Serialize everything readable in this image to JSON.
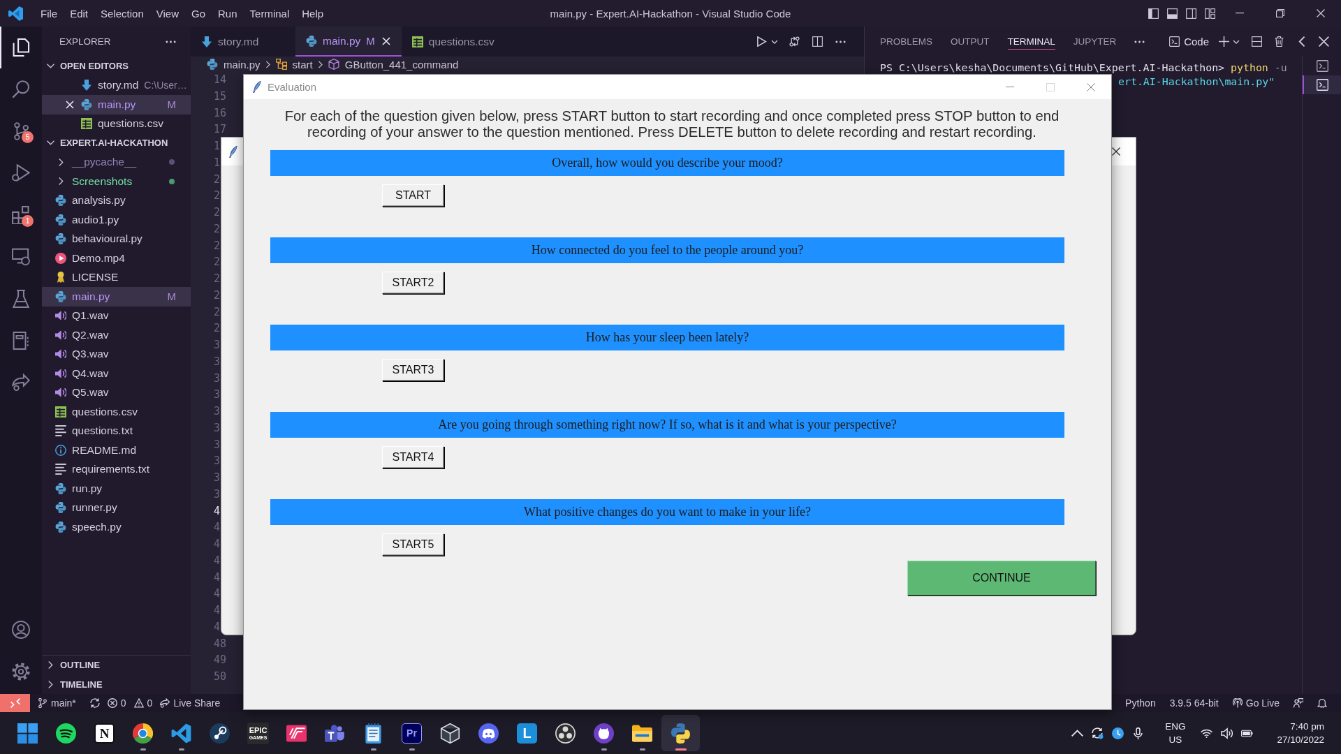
{
  "title_bar": {
    "menu": [
      "File",
      "Edit",
      "Selection",
      "View",
      "Go",
      "Run",
      "Terminal",
      "Help"
    ],
    "title": "main.py - Expert.AI-Hackathon - Visual Studio Code"
  },
  "activity_bar": {
    "items": [
      {
        "kind": "explorer",
        "selected": true
      },
      {
        "kind": "search",
        "selected": false
      },
      {
        "kind": "source-control",
        "selected": false,
        "badge": "5"
      },
      {
        "kind": "run-debug",
        "selected": false
      },
      {
        "kind": "extensions",
        "selected": false,
        "badge": "1"
      },
      {
        "kind": "remote",
        "selected": false
      },
      {
        "kind": "testing",
        "selected": false
      },
      {
        "kind": "notebook",
        "selected": false
      },
      {
        "kind": "live-share",
        "selected": false
      }
    ],
    "bottom": [
      {
        "kind": "account"
      },
      {
        "kind": "settings"
      }
    ]
  },
  "sidebar": {
    "title": "EXPLORER",
    "open_editors": {
      "label": "OPEN EDITORS",
      "expanded": true,
      "items": [
        {
          "name": "story.md",
          "kind": "markdown",
          "path": "C:\\User…",
          "selected": false,
          "close": false,
          "modified": false
        },
        {
          "name": "main.py",
          "kind": "python",
          "selected": true,
          "close": true,
          "modified": true,
          "badge": "M"
        },
        {
          "name": "questions.csv",
          "kind": "csv",
          "selected": false,
          "close": false,
          "modified": false
        }
      ]
    },
    "folder": {
      "label": "EXPERT.AI-HACKATHON",
      "expanded": true,
      "items": [
        {
          "name": "__pycache__",
          "kind": "folder",
          "expanded": false,
          "selected": false,
          "modified": false,
          "ignored": true,
          "untracked": false
        },
        {
          "name": "Screenshots",
          "kind": "folder",
          "expanded": false,
          "selected": false,
          "modified": false,
          "ignored": false,
          "untracked": true
        },
        {
          "name": "analysis.py",
          "kind": "python",
          "selected": false,
          "modified": false,
          "ignored": false,
          "untracked": false
        },
        {
          "name": "audio1.py",
          "kind": "python",
          "selected": false,
          "modified": false,
          "ignored": false,
          "untracked": false
        },
        {
          "name": "behavioural.py",
          "kind": "python",
          "selected": false,
          "modified": false,
          "ignored": false,
          "untracked": false
        },
        {
          "name": "Demo.mp4",
          "kind": "video",
          "selected": false,
          "modified": false,
          "ignored": false,
          "untracked": false
        },
        {
          "name": "LICENSE",
          "kind": "license",
          "selected": false,
          "modified": false,
          "ignored": false,
          "untracked": false
        },
        {
          "name": "main.py",
          "kind": "python",
          "selected": true,
          "modified": true,
          "ignored": false,
          "untracked": false,
          "badge": "M"
        },
        {
          "name": "Q1.wav",
          "kind": "audio",
          "selected": false,
          "modified": false,
          "ignored": false,
          "untracked": false
        },
        {
          "name": "Q2.wav",
          "kind": "audio",
          "selected": false,
          "modified": false,
          "ignored": false,
          "untracked": false
        },
        {
          "name": "Q3.wav",
          "kind": "audio",
          "selected": false,
          "modified": false,
          "ignored": false,
          "untracked": false
        },
        {
          "name": "Q4.wav",
          "kind": "audio",
          "selected": false,
          "modified": false,
          "ignored": false,
          "untracked": false
        },
        {
          "name": "Q5.wav",
          "kind": "audio",
          "selected": false,
          "modified": false,
          "ignored": false,
          "untracked": false
        },
        {
          "name": "questions.csv",
          "kind": "csv",
          "selected": false,
          "modified": false,
          "ignored": false,
          "untracked": false
        },
        {
          "name": "questions.txt",
          "kind": "text",
          "selected": false,
          "modified": false,
          "ignored": false,
          "untracked": false
        },
        {
          "name": "README.md",
          "kind": "info",
          "selected": false,
          "modified": false,
          "ignored": false,
          "untracked": false
        },
        {
          "name": "requirements.txt",
          "kind": "text",
          "selected": false,
          "modified": false,
          "ignored": false,
          "untracked": false
        },
        {
          "name": "run.py",
          "kind": "python",
          "selected": false,
          "modified": false,
          "ignored": false,
          "untracked": false
        },
        {
          "name": "runner.py",
          "kind": "python",
          "selected": false,
          "modified": false,
          "ignored": false,
          "untracked": false
        },
        {
          "name": "speech.py",
          "kind": "python",
          "selected": false,
          "modified": false,
          "ignored": false,
          "untracked": false
        }
      ]
    },
    "sections": [
      {
        "label": "OUTLINE",
        "expanded": false
      },
      {
        "label": "TIMELINE",
        "expanded": false
      }
    ]
  },
  "editor": {
    "tabs": [
      {
        "name": "story.md",
        "kind": "markdown",
        "selected": false,
        "modified": false
      },
      {
        "name": "main.py",
        "kind": "python",
        "selected": true,
        "modified": true,
        "badge": "M"
      },
      {
        "name": "questions.csv",
        "kind": "csv",
        "selected": false,
        "modified": false
      }
    ],
    "breadcrumbs": [
      {
        "label": "main.py",
        "kind": "python"
      },
      {
        "label": "start",
        "kind": "class"
      },
      {
        "label": "GButton_441_command",
        "kind": "method"
      }
    ],
    "line_numbers": [
      {
        "text": "14",
        "current": false
      },
      {
        "text": "15",
        "current": false
      },
      {
        "text": "16",
        "current": false
      },
      {
        "text": "17",
        "current": false
      },
      {
        "text": "1",
        "current": false
      },
      {
        "text": "1",
        "current": false
      },
      {
        "text": "2",
        "current": false
      },
      {
        "text": "2",
        "current": false
      },
      {
        "text": "2",
        "current": false
      },
      {
        "text": "2",
        "current": false
      },
      {
        "text": "2",
        "current": false
      },
      {
        "text": "2",
        "current": false
      },
      {
        "text": "2",
        "current": false
      },
      {
        "text": "2",
        "current": false
      },
      {
        "text": "2",
        "current": false
      },
      {
        "text": "2",
        "current": false
      },
      {
        "text": "3",
        "current": false
      },
      {
        "text": "3",
        "current": false
      },
      {
        "text": "3",
        "current": false
      },
      {
        "text": "3",
        "current": false
      },
      {
        "text": "3",
        "current": false
      },
      {
        "text": "3",
        "current": false
      },
      {
        "text": "3",
        "current": false
      },
      {
        "text": "3",
        "current": false
      },
      {
        "text": "3",
        "current": false
      },
      {
        "text": "3",
        "current": false
      },
      {
        "text": "4",
        "current": true
      },
      {
        "text": "4",
        "current": false
      },
      {
        "text": "4",
        "current": false
      },
      {
        "text": "4",
        "current": false
      },
      {
        "text": "4",
        "current": false
      },
      {
        "text": "4",
        "current": false
      },
      {
        "text": "4",
        "current": false
      },
      {
        "text": "4",
        "current": false
      },
      {
        "text": "48",
        "current": false
      },
      {
        "text": "49",
        "current": false
      },
      {
        "text": "50",
        "current": false
      }
    ]
  },
  "panel": {
    "tabs": [
      {
        "label": "PROBLEMS",
        "selected": false
      },
      {
        "label": "OUTPUT",
        "selected": false
      },
      {
        "label": "TERMINAL",
        "selected": true
      },
      {
        "label": "JUPYTER",
        "selected": false
      }
    ],
    "terminal_profile": "Code",
    "terminal_lines": [
      {
        "kind": "command",
        "segments": [
          {
            "text": "PS C:\\Users\\kesha\\Documents\\GitHub\\Expert.AI-Hackathon>",
            "kind": "prompt"
          },
          {
            "text": "python",
            "kind": "command"
          },
          {
            "text": "-u",
            "kind": "flag"
          }
        ]
      },
      {
        "kind": "wrapped",
        "segments": [
          {
            "text": "ert.AI-Hackathon\\main.py\"",
            "kind": "string"
          }
        ]
      }
    ],
    "terminals": [
      {
        "selected": false
      },
      {
        "selected": true
      }
    ]
  },
  "dialog": {
    "title": "Evaluation",
    "maximize_disabled": true,
    "instructions": "For each of the question given below, press START button to start recording and once completed press STOP button to end recording of your answer to the question mentioned. Press DELETE button to delete recording and restart recording.",
    "questions": [
      {
        "text": "Overall, how would you describe your mood?",
        "button": "START"
      },
      {
        "text": "How connected do you feel to the people around you?",
        "button": "START2"
      },
      {
        "text": "How has your sleep been lately?",
        "button": "START3"
      },
      {
        "text": "Are you going through something right now? If so, what is it and what is your perspective?",
        "button": "START4"
      },
      {
        "text": "What positive changes do you want to make in your life?",
        "button": "START5"
      }
    ],
    "continue": "CONTINUE"
  },
  "status_bar": {
    "left": [
      {
        "kind": "remote"
      },
      {
        "kind": "branch",
        "text": "main*"
      },
      {
        "kind": "sync"
      },
      {
        "kind": "errors",
        "text": "0"
      },
      {
        "kind": "warnings",
        "text": "0"
      },
      {
        "kind": "live-share",
        "text": "Live Share"
      }
    ],
    "right": [
      {
        "kind": "language",
        "text": "Python"
      },
      {
        "kind": "interpreter",
        "text": "3.9.5 64-bit"
      },
      {
        "kind": "go-live",
        "text": "Go Live"
      },
      {
        "kind": "feedback"
      },
      {
        "kind": "notifications"
      }
    ]
  },
  "taskbar": {
    "apps": [
      {
        "kind": "start",
        "running": false,
        "selected": false
      },
      {
        "kind": "music",
        "running": false,
        "selected": false
      },
      {
        "kind": "letter-light",
        "glyph": "N",
        "running": false,
        "selected": false
      },
      {
        "kind": "browser",
        "running": true,
        "selected": false
      },
      {
        "kind": "code",
        "running": true,
        "selected": false
      },
      {
        "kind": "steam",
        "running": false,
        "selected": false
      },
      {
        "kind": "store",
        "glyph": "EPIC",
        "sub": "GAMES",
        "running": false,
        "selected": false
      },
      {
        "kind": "stripes",
        "running": false,
        "selected": false
      },
      {
        "kind": "team",
        "running": false,
        "selected": false
      },
      {
        "kind": "notepad",
        "running": true,
        "selected": false
      },
      {
        "kind": "letter-navy",
        "glyph": "Pr",
        "running": true,
        "selected": false
      },
      {
        "kind": "cube",
        "running": false,
        "selected": false
      },
      {
        "kind": "chat",
        "running": false,
        "selected": false
      },
      {
        "kind": "letter-blue",
        "glyph": "L",
        "running": false,
        "selected": false
      },
      {
        "kind": "aperture",
        "running": false,
        "selected": false
      },
      {
        "kind": "cat",
        "running": true,
        "selected": false
      },
      {
        "kind": "folder",
        "running": true,
        "selected": false
      },
      {
        "kind": "python",
        "running": true,
        "selected": true
      }
    ],
    "tray": [
      {
        "kind": "chevron"
      },
      {
        "kind": "sync"
      },
      {
        "kind": "clock"
      },
      {
        "kind": "mic"
      }
    ],
    "language": [
      "ENG",
      "US"
    ],
    "system": [
      {
        "kind": "wifi"
      },
      {
        "kind": "volume"
      },
      {
        "kind": "battery"
      }
    ],
    "time": "7:40 pm",
    "date": "27/10/2022"
  }
}
